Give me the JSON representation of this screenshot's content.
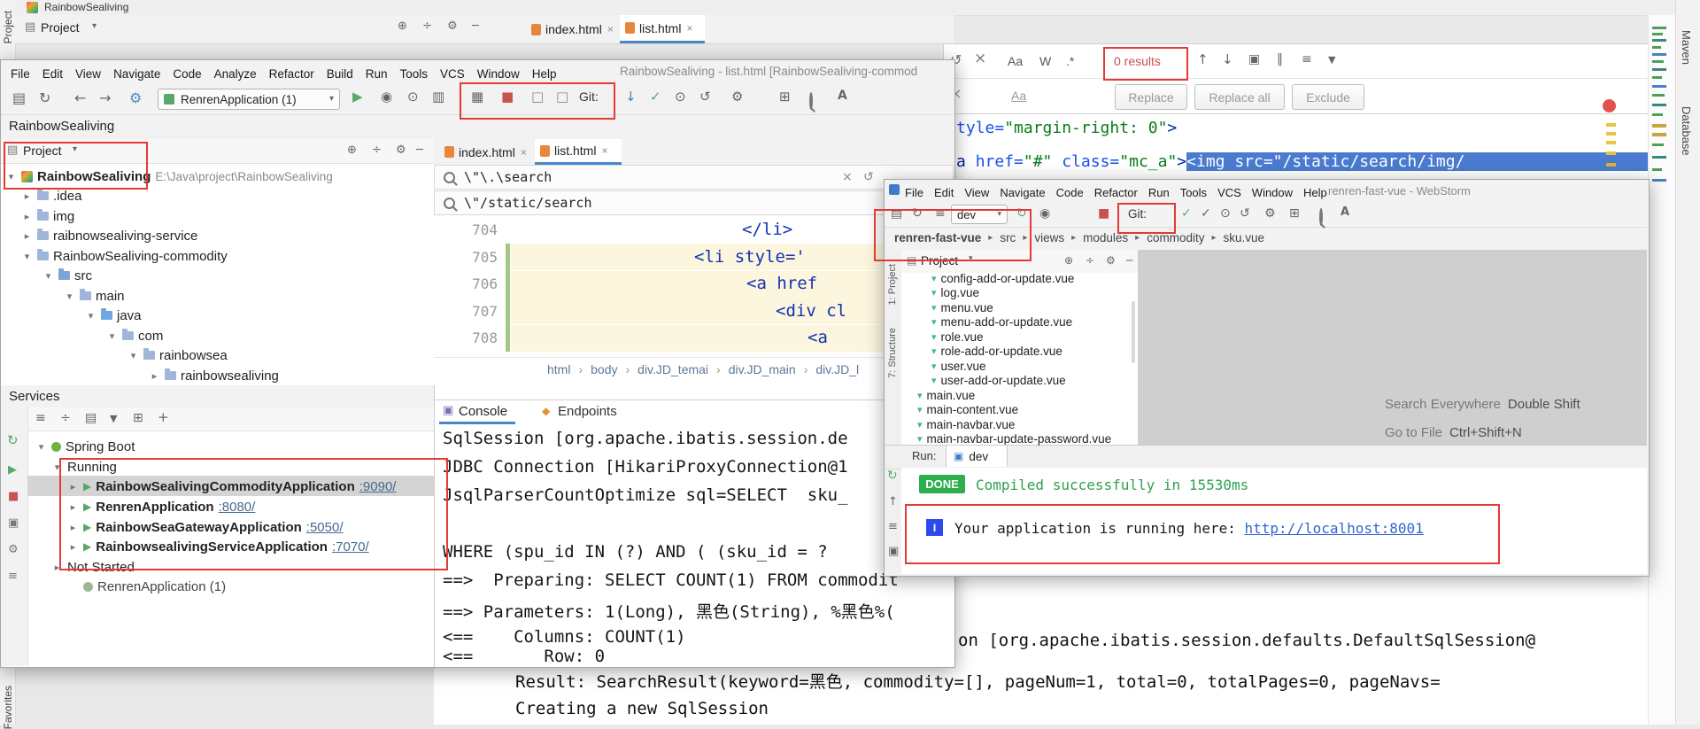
{
  "icons": {
    "chev_down": "▾",
    "chev_right": "▸",
    "menu": "≡",
    "save": "▤",
    "sync": "↻",
    "back": "←",
    "forward": "→",
    "gear": "⚙",
    "run": "▶",
    "stop": "■",
    "debug": "◉",
    "coverage": "⊙",
    "profiler": "▥",
    "dashboard": "▦",
    "square": "□",
    "update": "↓",
    "commit": "✓",
    "history": "⊙",
    "undo": "↺",
    "grid": "⊞",
    "translate": "A",
    "close": "×",
    "collapse": "⊟",
    "expand": "⊕",
    "hide": "─",
    "up": "↑",
    "down": "↓",
    "filter": "▼",
    "plus": "+",
    "divide": "÷",
    "pin": "‖",
    "camera": "▣",
    "console": "▣",
    "endpoints": "◆",
    "match_case": "Aa",
    "words": "W",
    "regex": ".*",
    "preserve_case": "Aa",
    "vue": "▾",
    "dot": "●"
  },
  "win1": {
    "title": "RainbowSealiving",
    "left_tab_top": "Project",
    "left_tab_bottom": "Favorites",
    "project_header": "Project",
    "tabs": [
      {
        "label": "index.html"
      },
      {
        "label": "list.html"
      }
    ],
    "find": {
      "results": "0 results",
      "replace": "Replace",
      "replace_all": "Replace all",
      "exclude": "Exclude"
    },
    "code1": {
      "a": "tyle=",
      "s": "\"margin-right: 0\"",
      "t": ">"
    },
    "code2": {
      "t1": "a ",
      "a1": "href=",
      "s1": "\"#\" ",
      "a2": "class=",
      "s2": "\"mc_a\"",
      "t2": ">",
      "sel": "<img src=\"/static/search/img/"
    },
    "right_tabs": [
      {
        "label": "Maven"
      },
      {
        "label": "Database"
      }
    ],
    "console": {
      "line_session": "on [org.apache.ibatis.session.defaults.DefaultSqlSession@",
      "line_result": "Result: SearchResult(keyword=黑色, commodity=[], pageNum=1, total=0, totalPages=0, pageNavs=",
      "line_creating": "Creating a new SqlSession"
    }
  },
  "ide": {
    "menu": [
      "File",
      "Edit",
      "View",
      "Navigate",
      "Code",
      "Analyze",
      "Refactor",
      "Build",
      "Run",
      "Tools",
      "VCS",
      "Window",
      "Help"
    ],
    "window_title": "RainbowSealiving - list.html [RainbowSealiving-commod",
    "run_config": "RenrenApplication (1)",
    "git_label": "Git:",
    "navbar_root": "RainbowSealiving",
    "project_header": "Project",
    "tree": [
      {
        "label": "RainbowSealiving",
        "path": "E:\\Java\\project\\RainbowSealiving"
      },
      {
        "label": ".idea"
      },
      {
        "label": "img"
      },
      {
        "label": "raibnowsealiving-service"
      },
      {
        "label": "RainbowSealiving-commodity"
      },
      {
        "label": "src"
      },
      {
        "label": "main"
      },
      {
        "label": "java"
      },
      {
        "label": "com"
      },
      {
        "label": "rainbowsea"
      },
      {
        "label": "rainbowsealiving"
      }
    ],
    "tabs": [
      {
        "label": "index.html"
      },
      {
        "label": "list.html"
      }
    ],
    "search1": "\\\"\\.\\search",
    "search2": "\\\"/static/search",
    "code": [
      {
        "num": "704",
        "text": "</li>"
      },
      {
        "num": "705",
        "text": "<li style='"
      },
      {
        "num": "706",
        "text": "<a href"
      },
      {
        "num": "707",
        "text": "<div cl"
      },
      {
        "num": "708",
        "text": "<a"
      }
    ],
    "breadcrumbs": [
      "html",
      "body",
      "div.JD_temai",
      "div.JD_main",
      "div.JD_l"
    ]
  },
  "services": {
    "title": "Services",
    "root": "Spring Boot",
    "running": "Running",
    "apps": [
      {
        "name": "RainbowSealivingCommodityApplication",
        "port": ":9090/"
      },
      {
        "name": "RenrenApplication",
        "port": ":8080/"
      },
      {
        "name": "RainbowSeaGatewayApplication",
        "port": ":5050/"
      },
      {
        "name": "RainbowsealivingServiceApplication",
        "port": ":7070/"
      }
    ],
    "not_started": "Not Started",
    "not_started_item": "RenrenApplication (1)"
  },
  "console": {
    "tabs": [
      "Console",
      "Endpoints"
    ],
    "lines": [
      "SqlSession [org.apache.ibatis.session.de",
      "JDBC Connection [HikariProxyConnection@1",
      "JsqlParserCountOptimize sql=SELECT  sku_",
      "",
      "WHERE (spu_id IN (?) AND ( (sku_id = ?",
      "==>  Preparing: SELECT COUNT(1) FROM commodit",
      "==> Parameters: 1(Long), 黑色(String), %黑色%(",
      "<==    Columns: COUNT(1)",
      "<==       Row: 0"
    ]
  },
  "webstorm": {
    "menu": [
      "File",
      "Edit",
      "View",
      "Navigate",
      "Code",
      "Refactor",
      "Run",
      "Tools",
      "VCS",
      "Window",
      "Help"
    ],
    "window_title": "renren-fast-vue - WebStorm",
    "run_config": "dev",
    "git_label": "Git:",
    "breadcrumbs": [
      "renren-fast-vue",
      "src",
      "views",
      "modules",
      "commodity",
      "sku.vue"
    ],
    "project_header": "Project",
    "left_tabs": [
      "1: Project",
      "7: Structure"
    ],
    "files": [
      "config-add-or-update.vue",
      "log.vue",
      "menu.vue",
      "menu-add-or-update.vue",
      "role.vue",
      "role-add-or-update.vue",
      "user.vue",
      "user-add-or-update.vue",
      "main.vue",
      "main-content.vue",
      "main-navbar.vue",
      "main-navbar-update-password.vue"
    ],
    "hints": [
      {
        "label": "Search Everywhere",
        "shortcut": "Double Shift"
      },
      {
        "label": "Go to File",
        "shortcut": "Ctrl+Shift+N"
      }
    ],
    "run_label": "Run:",
    "run_tab": "dev",
    "done_badge": "DONE",
    "compiled": "Compiled successfully in 15530ms",
    "info_badge": "I",
    "running_text": "Your application is running here: ",
    "running_link": "http://localhost:8001"
  }
}
